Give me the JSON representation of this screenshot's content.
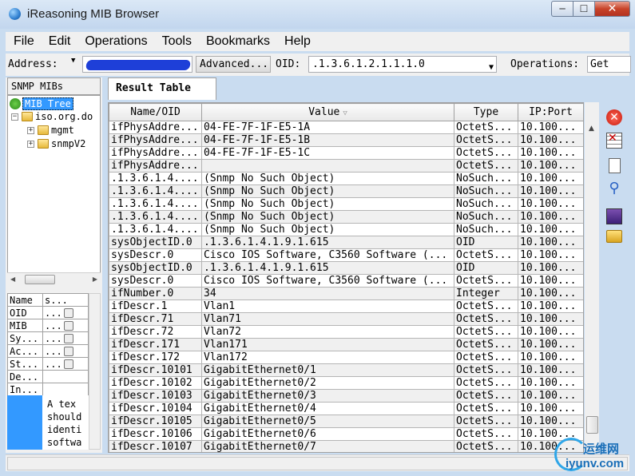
{
  "window": {
    "title": "iReasoning MIB Browser",
    "controls": [
      "─",
      "☐",
      "✕"
    ]
  },
  "menu": [
    "File",
    "Edit",
    "Operations",
    "Tools",
    "Bookmarks",
    "Help"
  ],
  "toolbar": {
    "address_label": "Address:",
    "advanced_label": "Advanced...",
    "oid_label": "OID:",
    "oid_value": ".1.3.6.1.2.1.1.1.0",
    "operations_label": "Operations:",
    "operations_value": "Get"
  },
  "sidebar": {
    "header": "SNMP MIBs",
    "tree": {
      "root": "MIB Tree",
      "child": "iso.org.do",
      "grandchildren": [
        "mgmt",
        "snmpV2"
      ]
    },
    "properties": {
      "header": [
        "Name",
        "s..."
      ],
      "rows": [
        [
          "OID",
          "..."
        ],
        [
          "MIB",
          "..."
        ],
        [
          "Sy...",
          "..."
        ],
        [
          "Ac...",
          "..."
        ],
        [
          "St...",
          "..."
        ],
        [
          "De...",
          ""
        ],
        [
          "In...",
          ""
        ]
      ]
    },
    "description_text": "A tex\nshould\nidenti\nsoftwa"
  },
  "tab": {
    "label": "Result Table"
  },
  "table": {
    "columns": [
      "Name/OID",
      "Value",
      "Type",
      "IP:Port"
    ],
    "sort_indicator": "▽",
    "rows": [
      [
        "ifPhysAddre...",
        "04-FE-7F-1F-E5-1A",
        "OctetS...",
        "10.100..."
      ],
      [
        "ifPhysAddre...",
        "04-FE-7F-1F-E5-1B",
        "OctetS...",
        "10.100..."
      ],
      [
        "ifPhysAddre...",
        "04-FE-7F-1F-E5-1C",
        "OctetS...",
        "10.100..."
      ],
      [
        "ifPhysAddre...",
        "",
        "OctetS...",
        "10.100..."
      ],
      [
        ".1.3.6.1.4....",
        "(Snmp No Such Object)",
        "NoSuch...",
        "10.100..."
      ],
      [
        ".1.3.6.1.4....",
        "(Snmp No Such Object)",
        "NoSuch...",
        "10.100..."
      ],
      [
        ".1.3.6.1.4....",
        "(Snmp No Such Object)",
        "NoSuch...",
        "10.100..."
      ],
      [
        ".1.3.6.1.4....",
        "(Snmp No Such Object)",
        "NoSuch...",
        "10.100..."
      ],
      [
        ".1.3.6.1.4....",
        "(Snmp No Such Object)",
        "NoSuch...",
        "10.100..."
      ],
      [
        "sysObjectID.0",
        ".1.3.6.1.4.1.9.1.615",
        "OID",
        "10.100..."
      ],
      [
        "sysDescr.0",
        "Cisco IOS Software, C3560 Software (...",
        "OctetS...",
        "10.100..."
      ],
      [
        "sysObjectID.0",
        ".1.3.6.1.4.1.9.1.615",
        "OID",
        "10.100..."
      ],
      [
        "sysDescr.0",
        "Cisco IOS Software, C3560 Software (...",
        "OctetS...",
        "10.100..."
      ],
      [
        "ifNumber.0",
        "34",
        "Integer",
        "10.100..."
      ],
      [
        "ifDescr.1",
        "Vlan1",
        "OctetS...",
        "10.100..."
      ],
      [
        "ifDescr.71",
        "Vlan71",
        "OctetS...",
        "10.100..."
      ],
      [
        "ifDescr.72",
        "Vlan72",
        "OctetS...",
        "10.100..."
      ],
      [
        "ifDescr.171",
        "Vlan171",
        "OctetS...",
        "10.100..."
      ],
      [
        "ifDescr.172",
        "Vlan172",
        "OctetS...",
        "10.100..."
      ],
      [
        "ifDescr.10101",
        "GigabitEthernet0/1",
        "OctetS...",
        "10.100..."
      ],
      [
        "ifDescr.10102",
        "GigabitEthernet0/2",
        "OctetS...",
        "10.100..."
      ],
      [
        "ifDescr.10103",
        "GigabitEthernet0/3",
        "OctetS...",
        "10.100..."
      ],
      [
        "ifDescr.10104",
        "GigabitEthernet0/4",
        "OctetS...",
        "10.100..."
      ],
      [
        "ifDescr.10105",
        "GigabitEthernet0/5",
        "OctetS...",
        "10.100..."
      ],
      [
        "ifDescr.10106",
        "GigabitEthernet0/6",
        "OctetS...",
        "10.100..."
      ],
      [
        "ifDescr.10107",
        "GigabitEthernet0/7",
        "OctetS...",
        "10.100..."
      ]
    ]
  },
  "tools_icons": [
    "delete-icon",
    "clear-table-icon",
    "new-document-icon",
    "find-icon",
    "save-icon",
    "open-folder-icon"
  ],
  "watermark": {
    "cn": "运维网",
    "en": "iyunv.com"
  },
  "colors": {
    "selection": "#3399ff",
    "title_bar": "#c9dcf0",
    "close_button": "#c8442a"
  }
}
